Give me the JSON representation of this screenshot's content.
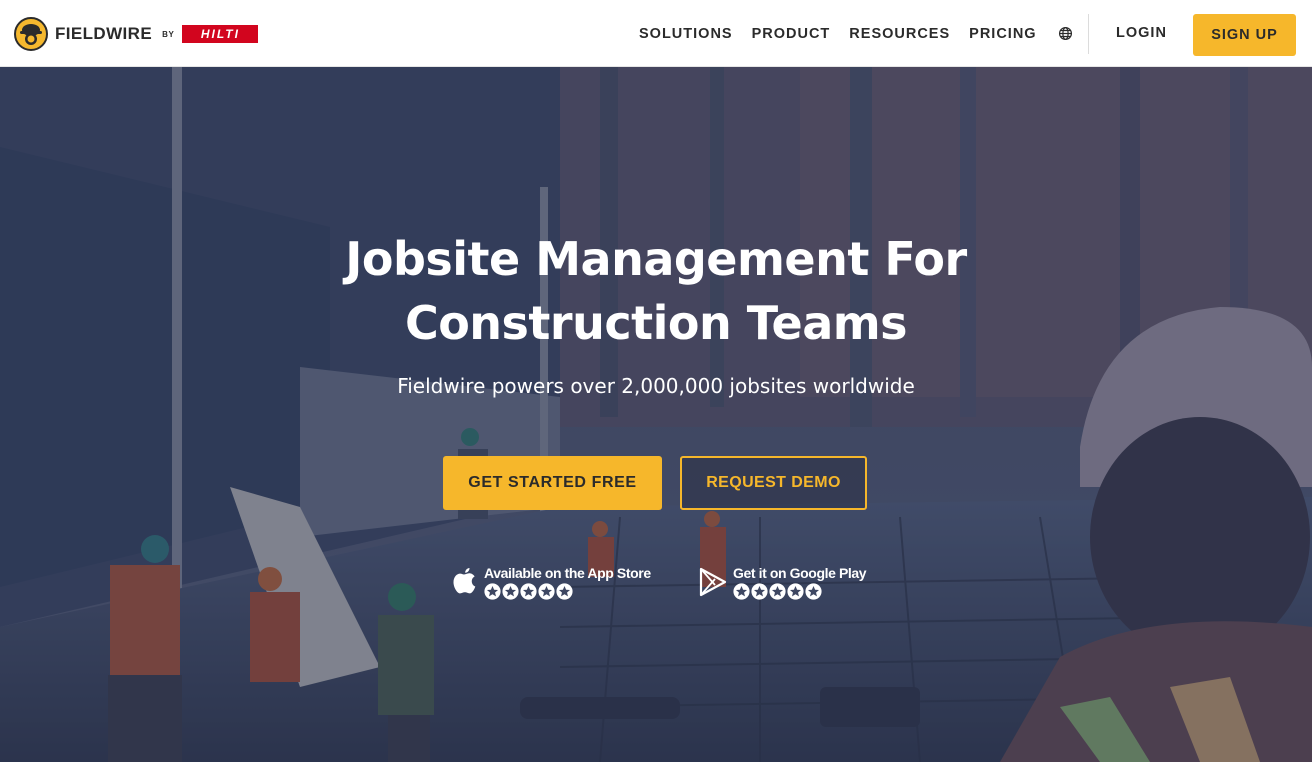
{
  "brand": {
    "name": "FIELDWIRE",
    "by": "BY",
    "partner": "HILTI",
    "accent": "#f6b72b",
    "partner_color": "#d2051e"
  },
  "nav": {
    "items": [
      {
        "label": "SOLUTIONS"
      },
      {
        "label": "PRODUCT"
      },
      {
        "label": "RESOURCES"
      },
      {
        "label": "PRICING"
      }
    ],
    "language_icon": "globe-icon",
    "login_label": "LOGIN",
    "signup_label": "SIGN UP"
  },
  "hero": {
    "title_line1": "Jobsite Management For",
    "title_line2": "Construction Teams",
    "subtitle": "Fieldwire powers over 2,000,000 jobsites worldwide",
    "primary_cta": "GET STARTED FREE",
    "secondary_cta": "REQUEST DEMO",
    "stores": [
      {
        "label": "Available on the App Store",
        "icon": "apple-icon",
        "rating": 5
      },
      {
        "label": "Get it on Google Play",
        "icon": "google-play-icon",
        "rating": 5
      }
    ]
  }
}
